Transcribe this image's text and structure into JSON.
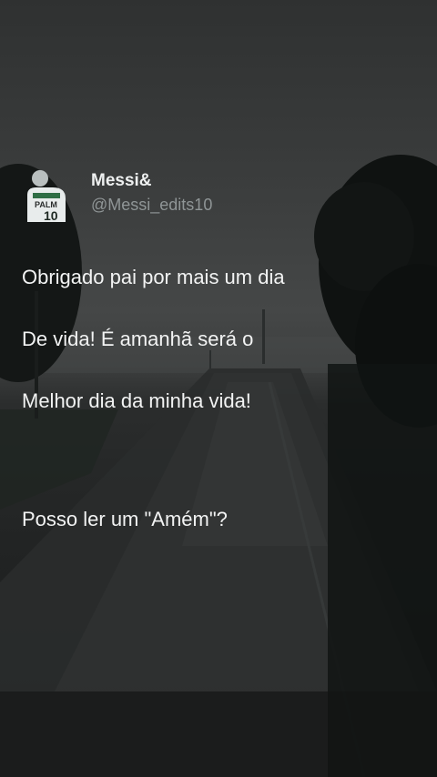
{
  "tweet": {
    "display_name": "Messi&",
    "handle": "@Messi_edits10",
    "lines": [
      "Obrigado pai por mais um dia",
      "De vida! É amanhã será o",
      "Melhor dia da minha vida!"
    ],
    "question": "Posso ler um \"Amém\"?"
  },
  "colors": {
    "text": "#f2f3f3",
    "handle": "#8f9596",
    "sky": "#454747"
  },
  "icons": {
    "avatar": "player-avatar-icon"
  }
}
